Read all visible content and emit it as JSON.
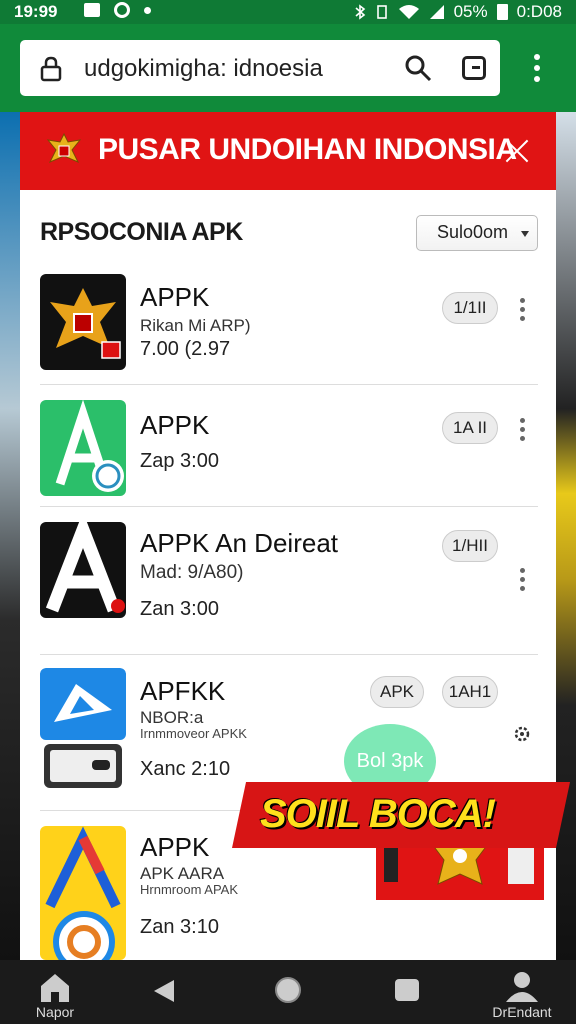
{
  "status_bar": {
    "time": "19:99",
    "battery": "05%",
    "clock_right": "0:D08"
  },
  "browser": {
    "url": "udgokimigha: idnoesia"
  },
  "modal": {
    "header_title": "PUSAR UNDOIHAN INDONSIA",
    "section_title": "RPSOCONIA APK",
    "sort_value": "Sulo0om"
  },
  "apps": [
    {
      "title": "APPK",
      "subtitle": "Rikan Mi ARP)",
      "meta": "7.00 (2.97",
      "pill": "1/1II"
    },
    {
      "title": "APPK",
      "meta": "Zap 3:00",
      "pill": "1A II"
    },
    {
      "title": "APPK An Deireat",
      "subtitle": "Mad: 9/A80)",
      "meta": "Zan 3:00",
      "pill": "1/HII"
    },
    {
      "title": "APFKK",
      "subtitle": "NBOR:a",
      "subtitle2": "Irnmmoveor APKK",
      "meta": "Xanc 2:10",
      "pill": "APK",
      "pill2": "1AH1"
    },
    {
      "title": "APPK",
      "subtitle": "APK AARA",
      "subtitle2": "Hrnmroom APAK",
      "meta": "Zan 3:10"
    }
  ],
  "action_button": "Bol 3pk",
  "promo": {
    "text": "SOIIL BOCA!"
  },
  "nav": {
    "home_label": "Napor",
    "profile_label": "DrEndant"
  },
  "colors": {
    "header_red": "#e01414",
    "browser_green": "#108a3a",
    "promo_yellow": "#ffe01c",
    "action_green": "#7ee8b6"
  }
}
